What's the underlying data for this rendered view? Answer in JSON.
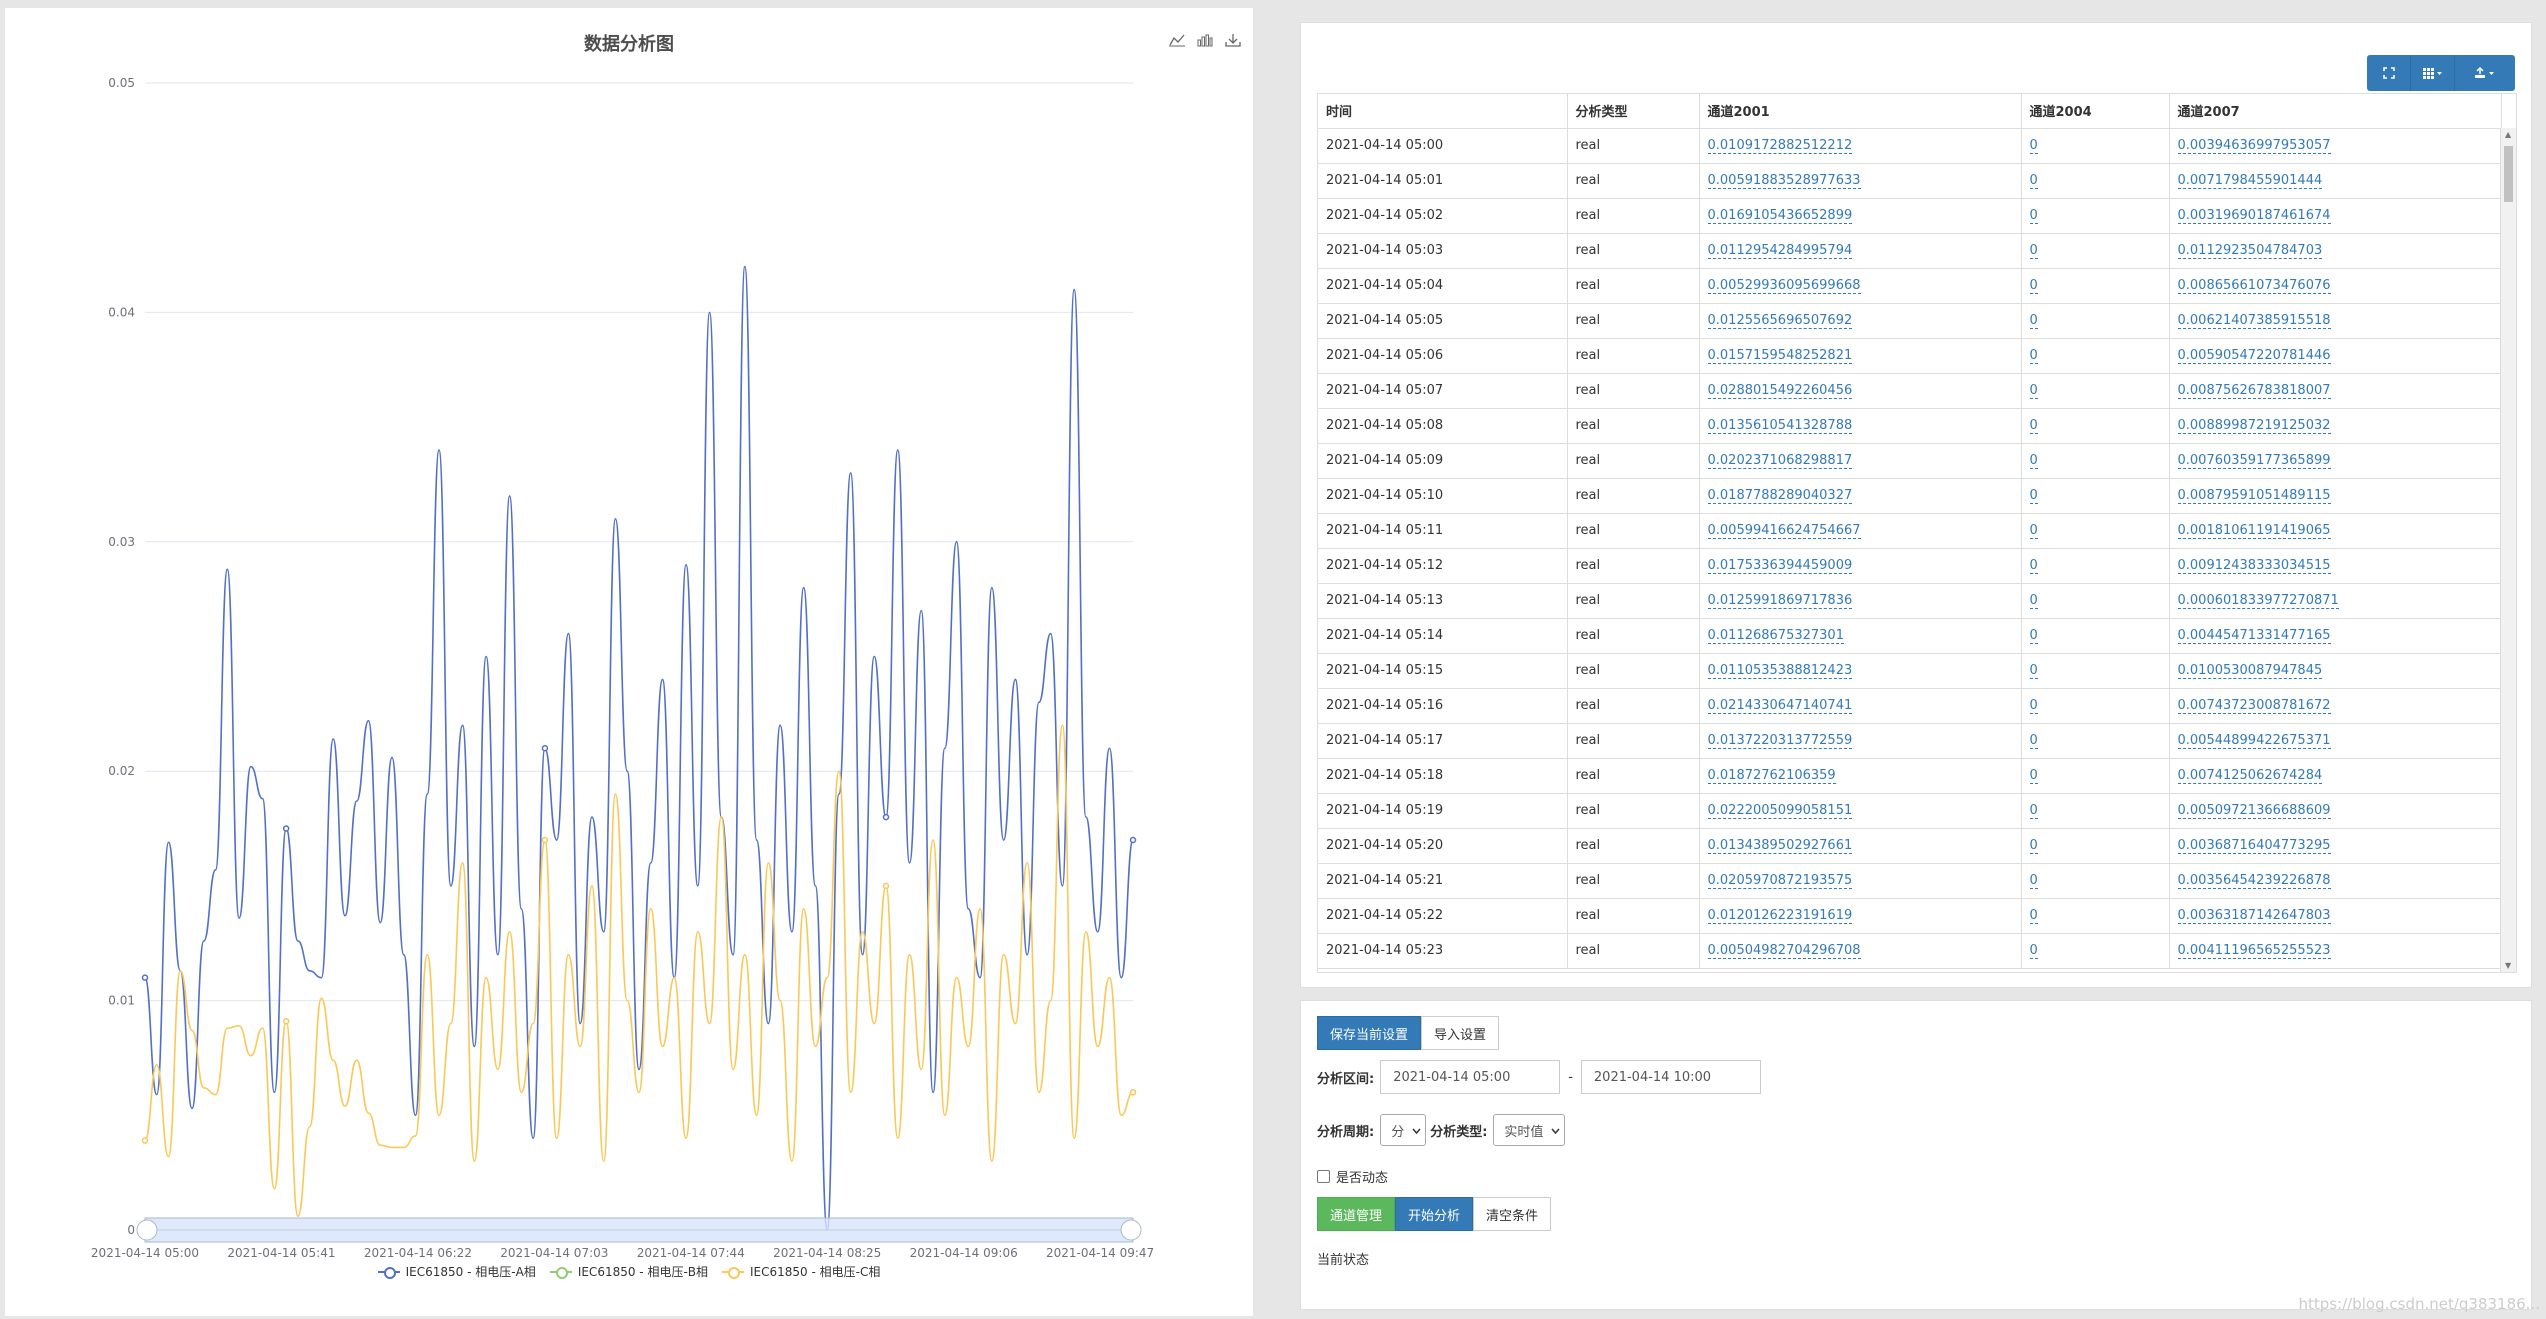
{
  "chart": {
    "title": "数据分析图",
    "tools": {
      "line_icon": "line-chart-icon",
      "bar_icon": "bar-chart-icon",
      "download_icon": "download-icon"
    }
  },
  "chart_data": {
    "type": "line",
    "title": "数据分析图",
    "xlabel": "",
    "ylabel": "",
    "ylim": [
      0,
      0.05
    ],
    "yticks": [
      "0",
      "0.01",
      "0.02",
      "0.03",
      "0.04",
      "0.05"
    ],
    "xticks": [
      "2021-04-14 05:00",
      "2021-04-14 05:41",
      "2021-04-14 06:22",
      "2021-04-14 07:03",
      "2021-04-14 07:44",
      "2021-04-14 08:25",
      "2021-04-14 09:06",
      "2021-04-14 09:47"
    ],
    "x_start": "2021-04-14 05:00",
    "x_end": "2021-04-14 10:00",
    "grid": true,
    "legend_position": "bottom-center",
    "series": [
      {
        "name": "IEC61850 - 相电压-A相",
        "color": "#5470c6",
        "values": [
          0.011,
          0.0059,
          0.0169,
          0.0113,
          0.0053,
          0.0126,
          0.0157,
          0.0288,
          0.0136,
          0.0202,
          0.0188,
          0.006,
          0.0175,
          0.0126,
          0.0113,
          0.011,
          0.0214,
          0.0137,
          0.0187,
          0.0222,
          0.0134,
          0.0206,
          0.012,
          0.005,
          0.019,
          0.034,
          0.015,
          0.022,
          0.008,
          0.025,
          0.012,
          0.032,
          0.014,
          0.004,
          0.021,
          0.017,
          0.026,
          0.009,
          0.018,
          0.013,
          0.031,
          0.02,
          0.007,
          0.016,
          0.024,
          0.011,
          0.029,
          0.015,
          0.04,
          0.018,
          0.012,
          0.042,
          0.017,
          0.009,
          0.022,
          0.013,
          0.028,
          0.015,
          0.0,
          0.019,
          0.033,
          0.012,
          0.025,
          0.018,
          0.034,
          0.016,
          0.027,
          0.006,
          0.021,
          0.03,
          0.014,
          0.011,
          0.028,
          0.017,
          0.024,
          0.012,
          0.023,
          0.026,
          0.015,
          0.041,
          0.018,
          0.013,
          0.021,
          0.011,
          0.017
        ]
      },
      {
        "name": "IEC61850 - 相电压-B相",
        "color": "#91cc75",
        "values": []
      },
      {
        "name": "IEC61850 - 相电压-C相",
        "color": "#fac858",
        "values": [
          0.0039,
          0.0072,
          0.0032,
          0.0113,
          0.0087,
          0.0062,
          0.0059,
          0.0088,
          0.0089,
          0.0076,
          0.0088,
          0.0018,
          0.0091,
          0.0006,
          0.0045,
          0.0101,
          0.0074,
          0.0054,
          0.0074,
          0.0051,
          0.0037,
          0.0036,
          0.0036,
          0.0041,
          0.012,
          0.005,
          0.009,
          0.016,
          0.003,
          0.011,
          0.007,
          0.013,
          0.006,
          0.009,
          0.017,
          0.004,
          0.012,
          0.008,
          0.015,
          0.003,
          0.019,
          0.01,
          0.006,
          0.014,
          0.008,
          0.011,
          0.004,
          0.013,
          0.009,
          0.018,
          0.007,
          0.012,
          0.005,
          0.016,
          0.01,
          0.003,
          0.014,
          0.008,
          0.011,
          0.02,
          0.006,
          0.013,
          0.009,
          0.015,
          0.004,
          0.012,
          0.007,
          0.017,
          0.005,
          0.011,
          0.008,
          0.014,
          0.003,
          0.012,
          0.009,
          0.016,
          0.006,
          0.01,
          0.022,
          0.004,
          0.013,
          0.008,
          0.011,
          0.005,
          0.006
        ]
      }
    ]
  },
  "table_toolbar": {
    "fullscreen_icon": "fullscreen-icon",
    "columns_icon": "columns-icon",
    "export_icon": "export-icon"
  },
  "table": {
    "headers": [
      "时间",
      "分析类型",
      "通道2001",
      "通道2004",
      "通道2007"
    ],
    "rows": [
      [
        "2021-04-14 05:00",
        "real",
        "0.0109172882512212",
        "0",
        "0.00394636997953057"
      ],
      [
        "2021-04-14 05:01",
        "real",
        "0.00591883528977633",
        "0",
        "0.0071798455901444"
      ],
      [
        "2021-04-14 05:02",
        "real",
        "0.0169105436652899",
        "0",
        "0.00319690187461674"
      ],
      [
        "2021-04-14 05:03",
        "real",
        "0.0112954284995794",
        "0",
        "0.0112923504784703"
      ],
      [
        "2021-04-14 05:04",
        "real",
        "0.00529936095699668",
        "0",
        "0.00865661073476076"
      ],
      [
        "2021-04-14 05:05",
        "real",
        "0.0125565696507692",
        "0",
        "0.00621407385915518"
      ],
      [
        "2021-04-14 05:06",
        "real",
        "0.0157159548252821",
        "0",
        "0.00590547220781446"
      ],
      [
        "2021-04-14 05:07",
        "real",
        "0.0288015492260456",
        "0",
        "0.00875626783818007"
      ],
      [
        "2021-04-14 05:08",
        "real",
        "0.0135610541328788",
        "0",
        "0.00889987219125032"
      ],
      [
        "2021-04-14 05:09",
        "real",
        "0.0202371068298817",
        "0",
        "0.00760359177365899"
      ],
      [
        "2021-04-14 05:10",
        "real",
        "0.0187788289040327",
        "0",
        "0.00879591051489115"
      ],
      [
        "2021-04-14 05:11",
        "real",
        "0.00599416624754667",
        "0",
        "0.00181061191419065"
      ],
      [
        "2021-04-14 05:12",
        "real",
        "0.0175336394459009",
        "0",
        "0.00912438333034515"
      ],
      [
        "2021-04-14 05:13",
        "real",
        "0.0125991869717836",
        "0",
        "0.000601833977270871"
      ],
      [
        "2021-04-14 05:14",
        "real",
        "0.011268675327301",
        "0",
        "0.00445471331477165"
      ],
      [
        "2021-04-14 05:15",
        "real",
        "0.0110535388812423",
        "0",
        "0.0100530087947845"
      ],
      [
        "2021-04-14 05:16",
        "real",
        "0.0214330647140741",
        "0",
        "0.00743723008781672"
      ],
      [
        "2021-04-14 05:17",
        "real",
        "0.0137220313772559",
        "0",
        "0.00544899422675371"
      ],
      [
        "2021-04-14 05:18",
        "real",
        "0.01872762106359",
        "0",
        "0.0074125062674284"
      ],
      [
        "2021-04-14 05:19",
        "real",
        "0.0222005099058151",
        "0",
        "0.00509721366688609"
      ],
      [
        "2021-04-14 05:20",
        "real",
        "0.0134389502927661",
        "0",
        "0.00368716404773295"
      ],
      [
        "2021-04-14 05:21",
        "real",
        "0.0205970872193575",
        "0",
        "0.00356454239226878"
      ],
      [
        "2021-04-14 05:22",
        "real",
        "0.0120126223191619",
        "0",
        "0.00363187142647803"
      ],
      [
        "2021-04-14 05:23",
        "real",
        "0.00504982704296708",
        "0",
        "0.00411196565255523"
      ]
    ]
  },
  "form": {
    "save_settings": "保存当前设置",
    "import_settings": "导入设置",
    "range_label": "分析区间:",
    "range_start": "2021-04-14 05:00",
    "range_sep": "-",
    "range_end": "2021-04-14 10:00",
    "period_label": "分析周期:",
    "period_value": "分",
    "type_label": "分析类型:",
    "type_value": "实时值",
    "dynamic_label": "是否动态",
    "channel_mgmt": "通道管理",
    "start_analysis": "开始分析",
    "clear_conditions": "清空条件",
    "status_label": "当前状态"
  },
  "watermark": "https://blog.csdn.net/q383186..."
}
